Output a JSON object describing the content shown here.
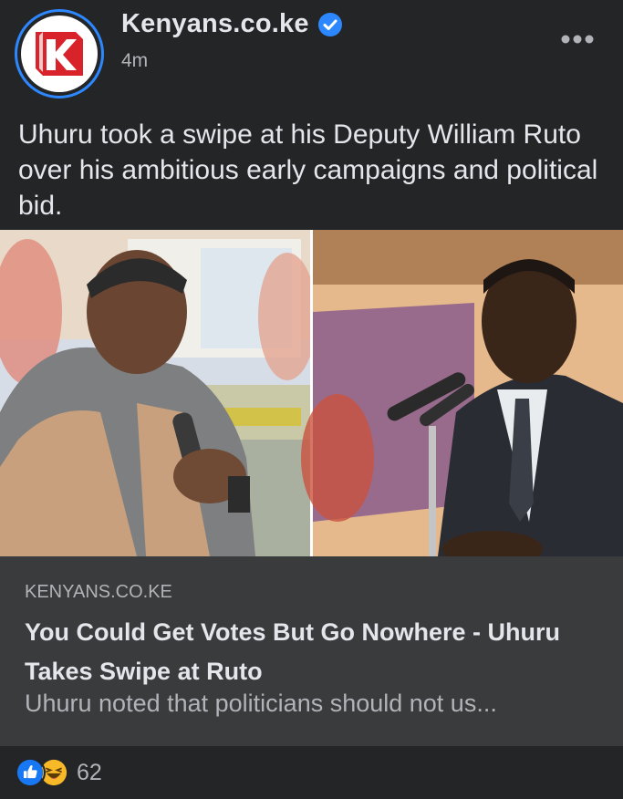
{
  "post": {
    "page_name": "Kenyans.co.ke",
    "time": "4m",
    "text": "Uhuru took a swipe at his Deputy William Ruto over his ambitious early campaigns and political bid.",
    "logo_letter": "K"
  },
  "link": {
    "domain": "KENYANS.CO.KE",
    "title": "You Could Get Votes But Go Nowhere - Uhuru Takes Swipe at Ruto",
    "description": "Uhuru noted that politicians should not us..."
  },
  "reactions": {
    "icons": [
      "like-icon",
      "haha-icon"
    ],
    "count": "62"
  },
  "colors": {
    "background": "#242527",
    "link_box": "#3a3b3c",
    "verified": "#2d88ff",
    "like": "#1877f2",
    "haha": "#f7b928",
    "logo_red": "#d8232a"
  }
}
